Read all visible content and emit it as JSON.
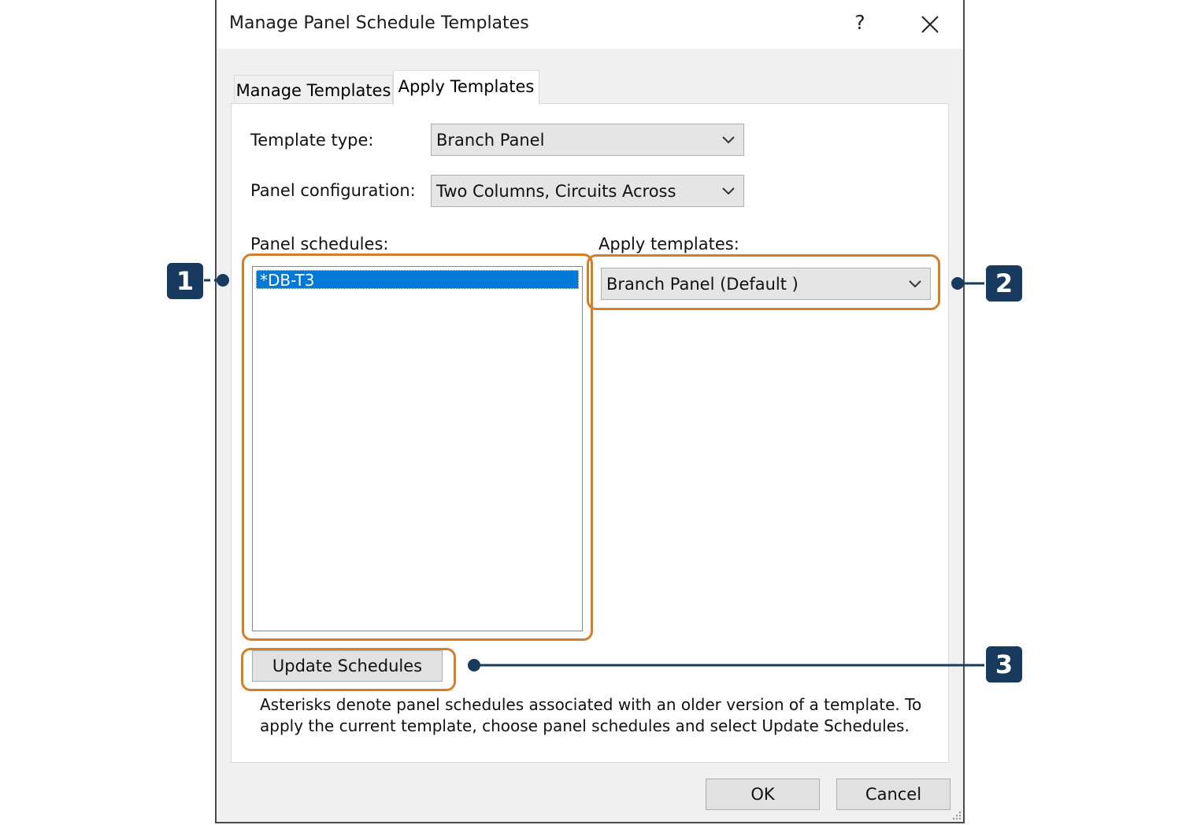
{
  "dialog": {
    "title": "Manage Panel Schedule Templates",
    "help_label": "?"
  },
  "tabs": [
    {
      "label": "Manage Templates",
      "active": false
    },
    {
      "label": "Apply Templates",
      "active": true
    }
  ],
  "form": {
    "template_type_label": "Template type:",
    "template_type_value": "Branch Panel",
    "panel_config_label": "Panel configuration:",
    "panel_config_value": "Two Columns, Circuits Across",
    "panel_schedules_label": "Panel schedules:",
    "panel_schedules": [
      "*DB-T3"
    ],
    "apply_templates_label": "Apply templates:",
    "apply_templates_value": "Branch Panel (Default )"
  },
  "update_button_label": "Update Schedules",
  "note": "Asterisks denote panel schedules associated with an older version of a template. To apply the current template, choose panel schedules and select Update Schedules.",
  "footer": {
    "ok_label": "OK",
    "cancel_label": "Cancel"
  },
  "callouts": [
    "1",
    "2",
    "3"
  ],
  "colors": {
    "highlight": "#d27f26",
    "callout": "#173a5e",
    "selection": "#0078d7"
  }
}
